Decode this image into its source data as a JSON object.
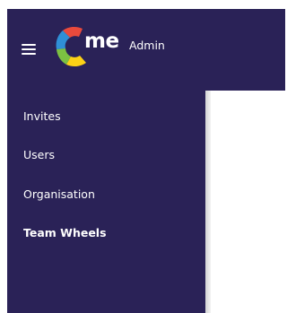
{
  "header": {
    "brand_name": "me",
    "brand_suffix": "Admin",
    "menu_icon": "hamburger-menu-icon",
    "logo_icon": "multicolor-c-logo",
    "background_color": "#2a2257"
  },
  "sidebar": {
    "background_color": "#2a2257",
    "active_item": "Team Wheels",
    "items": [
      {
        "label": "Invites"
      },
      {
        "label": "Users"
      },
      {
        "label": "Organisation"
      },
      {
        "label": "Team Wheels"
      }
    ]
  },
  "colors": {
    "logo_red": "#e94a3c",
    "logo_blue": "#2f8fd6",
    "logo_green": "#7cc142",
    "logo_yellow": "#fcd116",
    "text": "#ffffff"
  }
}
